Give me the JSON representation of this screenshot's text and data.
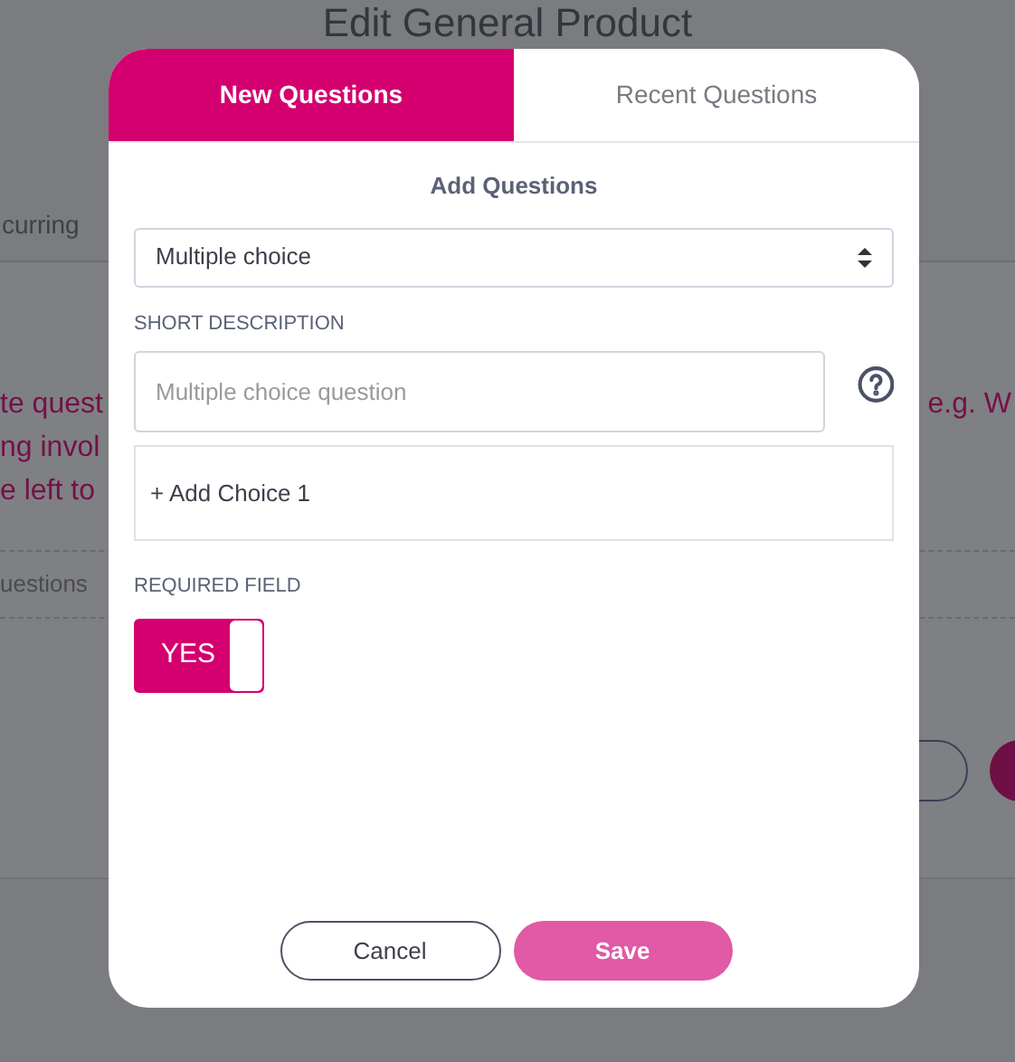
{
  "background": {
    "title": "Edit General Product",
    "tab_fragment": "curring",
    "text_lines": [
      {
        "left": "te quest",
        "right": "e.g. W"
      },
      {
        "left": "ng invol"
      },
      {
        "left": "e left to"
      }
    ],
    "row_fragment": "uestions"
  },
  "dialog": {
    "tabs": [
      {
        "label": "New Questions",
        "selected": true
      },
      {
        "label": "Recent Questions",
        "selected": false
      }
    ],
    "heading": "Add Questions",
    "type_select": {
      "value": "Multiple choice"
    },
    "description_label": "SHORT DESCRIPTION",
    "description_field": {
      "placeholder": "Multiple choice question"
    },
    "add_choice": "+ Add Choice 1",
    "required_label": "REQUIRED FIELD",
    "required_toggle": {
      "label": "YES",
      "on": true
    },
    "buttons": [
      {
        "label": "Cancel",
        "kind": "secondary"
      },
      {
        "label": "Save",
        "kind": "primary"
      }
    ]
  }
}
